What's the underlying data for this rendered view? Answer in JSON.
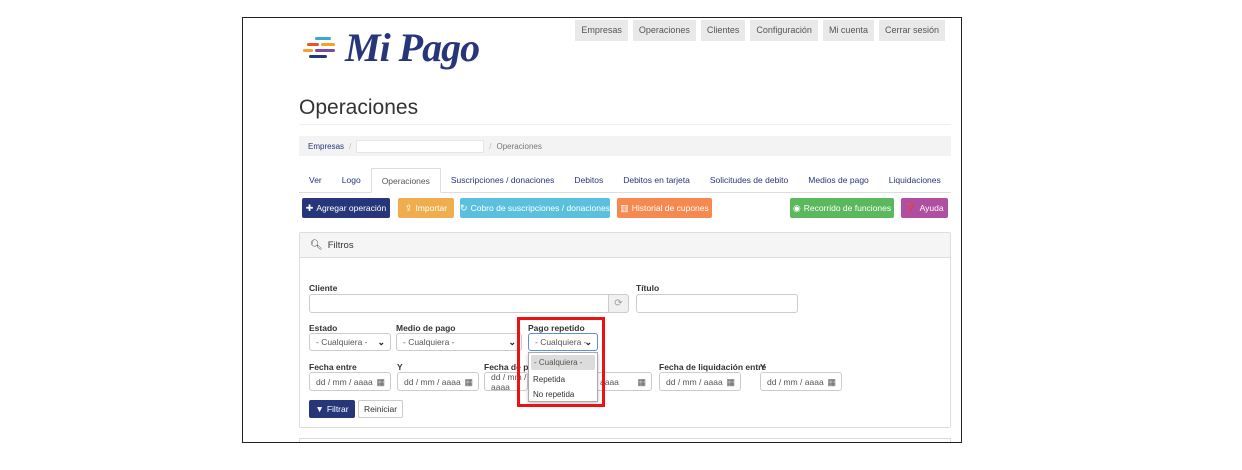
{
  "brand": {
    "logo_text": "Mi Pago",
    "logo_colors": [
      "#e8552a",
      "#f2a12b",
      "#3aa6d9",
      "#7c4a9e",
      "#27367a"
    ]
  },
  "topnav": [
    "Empresas",
    "Operaciones",
    "Clientes",
    "Configuración",
    "Mi cuenta",
    "Cerrar sesión"
  ],
  "page": {
    "title": "Operaciones"
  },
  "breadcrumb": {
    "first": "Empresas",
    "current": "Operaciones"
  },
  "tabs": [
    "Ver",
    "Logo",
    "Operaciones",
    "Suscripciones / donaciones",
    "Debitos",
    "Debitos en tarjeta",
    "Solicitudes de debito",
    "Medios de pago",
    "Liquidaciones"
  ],
  "active_tab": "Operaciones",
  "actions": {
    "agregar": "Agregar operación",
    "importar": "Importar",
    "cobro": "Cobro de suscripciones / donaciones",
    "historial": "Historial de cupones",
    "recorrido": "Recorrido de funciones",
    "ayuda": "Ayuda"
  },
  "action_colors": {
    "agregar": "#27367a",
    "importar": "#f0ad4e",
    "cobro": "#5bc0de",
    "historial": "#f5894f",
    "recorrido": "#5cb85c",
    "ayuda": "#b04fa0"
  },
  "filters": {
    "heading": "Filtros",
    "cliente_label": "Cliente",
    "titulo_label": "Título",
    "estado_label": "Estado",
    "estado_value": "- Cualquiera -",
    "medio_label": "Medio de pago",
    "medio_value": "- Cualquiera -",
    "pago_label": "Pago repetido",
    "pago_value": "- Cualquiera -",
    "fecha_entre_label": "Fecha entre",
    "y_label": "Y",
    "fecha_pago_label": "Fecha de pa",
    "fecha_liq_label": "Fecha de liquidación entre",
    "y2_label": "Y",
    "date_placeholder": "dd / mm / aaaa",
    "partial_date": "aaaa",
    "filtrar": "Filtrar",
    "reiniciar": "Reiniciar"
  },
  "dropdown_options": [
    "- Cualquiera -",
    "Repetida",
    "No repetida"
  ],
  "highlight_color": "#e11111"
}
